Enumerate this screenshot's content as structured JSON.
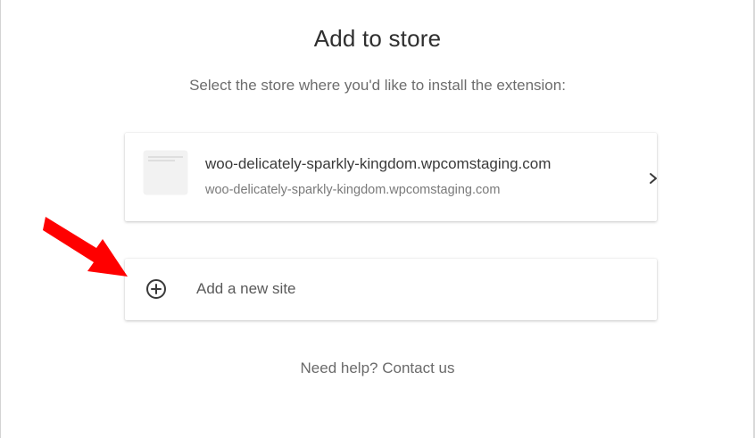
{
  "title": "Add to store",
  "subtitle": "Select the store where you'd like to install the extension:",
  "sites": [
    {
      "name": "woo-delicately-sparkly-kingdom.wpcomstaging.com",
      "url": "woo-delicately-sparkly-kingdom.wpcomstaging.com",
      "action_icon": "chevron-right-icon"
    }
  ],
  "add_site": {
    "label": "Add a new site",
    "icon": "plus-circle-icon"
  },
  "help": {
    "prefix": "Need help?",
    "link_label": "Contact us"
  },
  "annotation": {
    "icon": "red-pointer-arrow",
    "color": "#ff0000"
  },
  "colors": {
    "title": "#2f2f2f",
    "muted_text": "#6d6d6d",
    "card_bg": "#ffffff"
  }
}
